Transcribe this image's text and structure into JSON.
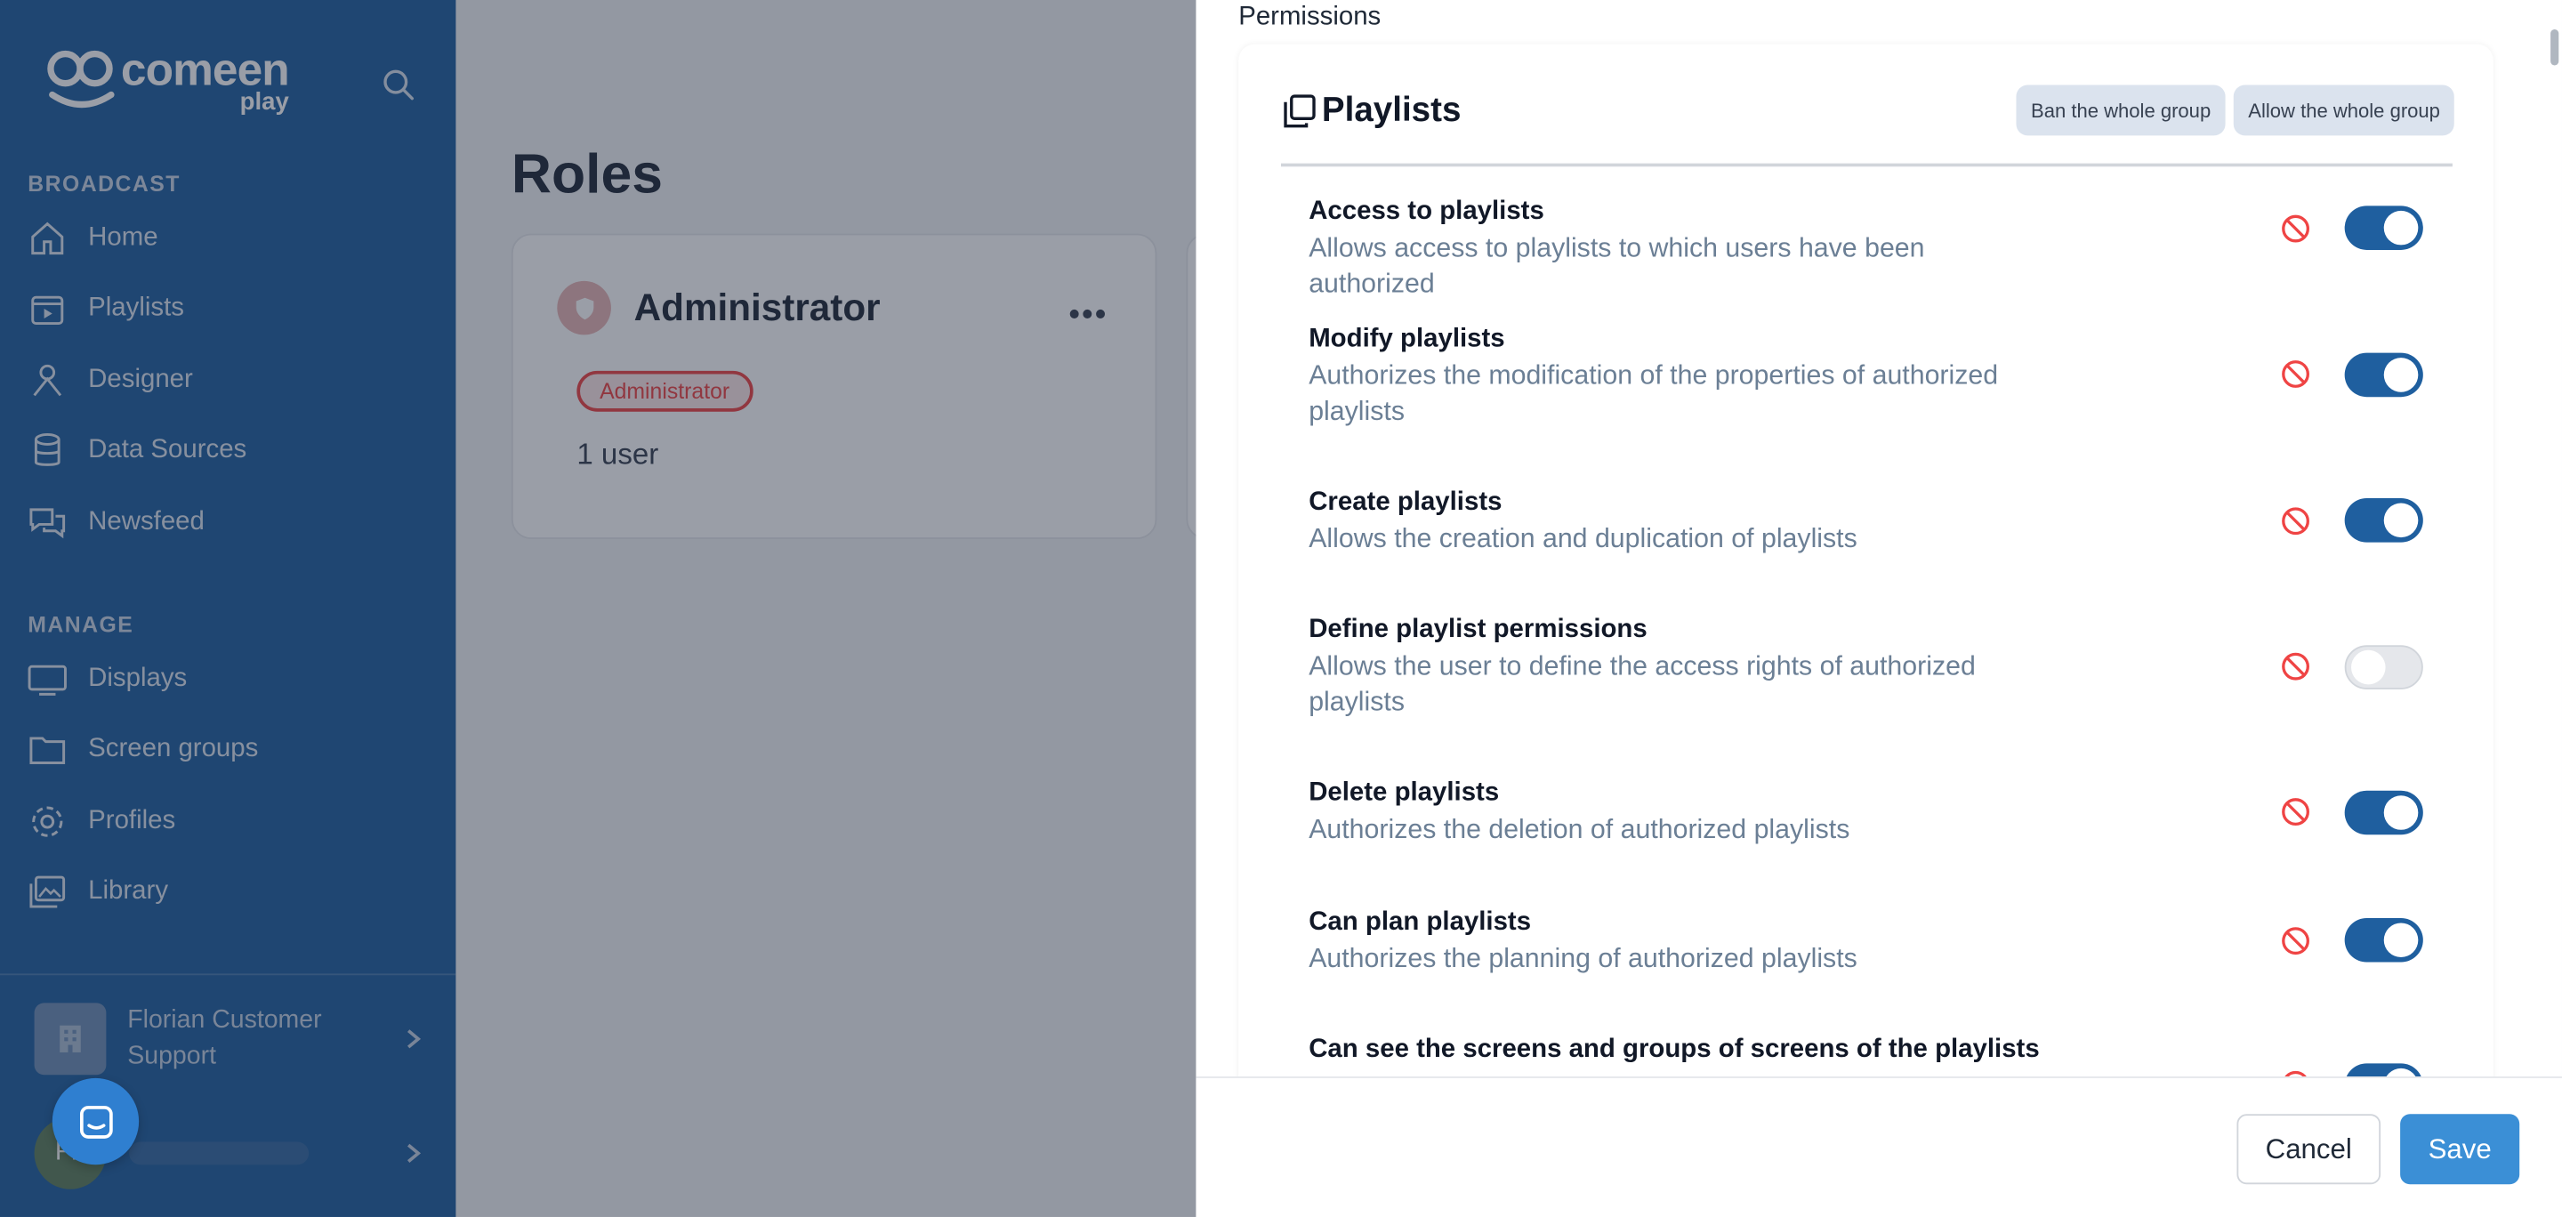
{
  "sidebar": {
    "brand": "comeen",
    "brand_sub": "play",
    "sections": [
      {
        "title": "BROADCAST",
        "items": [
          "Home",
          "Playlists",
          "Designer",
          "Data Sources",
          "Newsfeed"
        ]
      },
      {
        "title": "MANAGE",
        "items": [
          "Displays",
          "Screen groups",
          "Profiles",
          "Library"
        ]
      }
    ],
    "org_name": "Florian Customer Support",
    "user_initials": "FL"
  },
  "main": {
    "title": "Roles",
    "role": {
      "name": "Administrator",
      "badge": "Administrator",
      "users": "1 user"
    }
  },
  "panel": {
    "heading": "Permissions",
    "group": {
      "title": "Playlists",
      "ban_all": "Ban the whole group",
      "allow_all": "Allow the whole group"
    },
    "permissions": [
      {
        "title": "Access to playlists",
        "desc": "Allows access to playlists to which users have been authorized",
        "enabled": true
      },
      {
        "title": "Modify playlists",
        "desc": "Authorizes the modification of the properties of authorized playlists",
        "enabled": true
      },
      {
        "title": "Create playlists",
        "desc": "Allows the creation and duplication of playlists",
        "enabled": true
      },
      {
        "title": "Define playlist permissions",
        "desc": "Allows the user to define the access rights of authorized playlists",
        "enabled": false
      },
      {
        "title": "Delete playlists",
        "desc": "Authorizes the deletion of authorized playlists",
        "enabled": true
      },
      {
        "title": "Can plan playlists",
        "desc": "Authorizes the planning of authorized playlists",
        "enabled": true
      },
      {
        "title": "Can see the screens and groups of screens of the playlists",
        "desc": "",
        "enabled": true
      }
    ],
    "cancel": "Cancel",
    "save": "Save"
  },
  "colors": {
    "sidebar": "#1f5f9f",
    "toggle_on": "#1f5f9f",
    "save": "#3b8fd6",
    "ban": "#ef4444"
  }
}
